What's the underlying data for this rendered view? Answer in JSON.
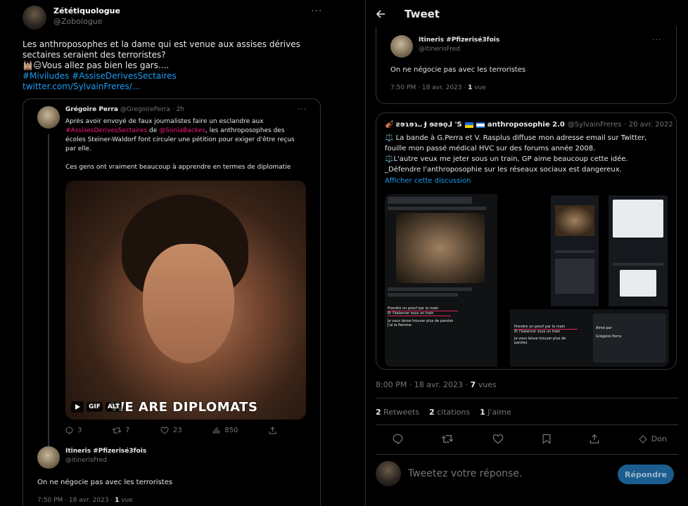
{
  "left": {
    "author": {
      "name": "Zététiquologue",
      "handle": "@Zobologue"
    },
    "text_line1": "Les anthroposophes et la dame qui est venue aux assises dérives",
    "text_line2": "sectaires seraient des terroristes?",
    "text_line3": "🕍😑Vous allez pas bien les gars....",
    "hashtags": "#Miviludes #AssiseDerivesSectaires",
    "link": "twitter.com/SylvainFreres/...",
    "quote": {
      "name": "Grégoire Perra",
      "handle": "@GregoirePerra",
      "time": "2h",
      "line1": "Après avoir envoyé de faux journalistes faire un esclandre aux",
      "line2_tag": "#AssisesDerivesSectaires",
      "line2_mid": " de ",
      "line2_mention": "@SoniaBackes",
      "line2_end": ", les anthroposophes des",
      "line3": "écoles Steiner-Waldorf font circuler une pétition pour exiger d'être reçus",
      "line4": "par elle.",
      "line5": "Ces gens ont vraiment beaucoup à apprendre en termes de diplomatie",
      "gif_caption": "WE ARE DIPLOMATS",
      "gif_badge": "GIF",
      "alt_badge": "ALT",
      "stats": {
        "replies": "3",
        "retweets": "7",
        "likes": "23",
        "views": "850"
      }
    },
    "reply": {
      "name": "Itineris #Pfizerisé3fois",
      "handle": "@itinerisFred",
      "text": "On ne négocie pas avec les terroristes",
      "time": "7:50 PM · 18 avr. 2023 · ",
      "views_count": "1",
      "views_label": " vue"
    }
  },
  "right": {
    "header_title": "Tweet",
    "top_tweet": {
      "name": "Itineris #Pfizerisé3fois",
      "handle": "@itinerisFred",
      "text": "On ne négocie pas avec les terroristes",
      "time": "7:50 PM · 18 avr. 2023 · ",
      "views_count": "1",
      "views_label": " vue"
    },
    "quoted": {
      "name_prefix": "🎻 ꙅɘɿɘɿ᎑ Ɉ ɘƨɘǫ⅃ 'S",
      "name": "anthroposophie 2.0",
      "handle": "@SylvainFreres",
      "date": "· 20 avr. 2022",
      "line1": "⚖️ La bande à G.Perra et V. Rasplus diffuse mon adresse email sur Twitter,",
      "line2": "fouille mon passé médical HVC sur des forums année 2008.",
      "line3": "⚖️L'autre veux me jeter sous un train, GP aime beaucoup cette idée.",
      "line4": "_Défendre l'anthroposophie sur les réseaux sociaux est dangereux.",
      "show_thread": "Afficher cette discussion",
      "mini": {
        "p1_header": "Prendre un poscf par la main",
        "p1_sub": "Et l'balancer sous un train",
        "p1_tail1": "Je vous laisse trouver plus de paroles",
        "p1_tail2": "J'ai la flemme",
        "p2_line1": "Prendre un poscf par la main",
        "p2_line2": "Et l'balancer sous un train",
        "p2_line3": "Je vous laisse trouver plus de paroles",
        "p3_name": "Grégoire Perra",
        "p3_action": "Aimé par"
      }
    },
    "meta": {
      "time": "8:00 PM · 18 avr. 2023 · ",
      "views_count": "7",
      "views_label": " vues"
    },
    "stats": {
      "retweets_count": "2",
      "retweets_label": " Retweets",
      "quotes_count": "2",
      "quotes_label": " citations",
      "likes_count": "1",
      "likes_label": " J'aime"
    },
    "actions": {
      "tip_label": "Don"
    },
    "reply_box": {
      "placeholder": "Tweetez votre réponse.",
      "button": "Répondre"
    }
  }
}
